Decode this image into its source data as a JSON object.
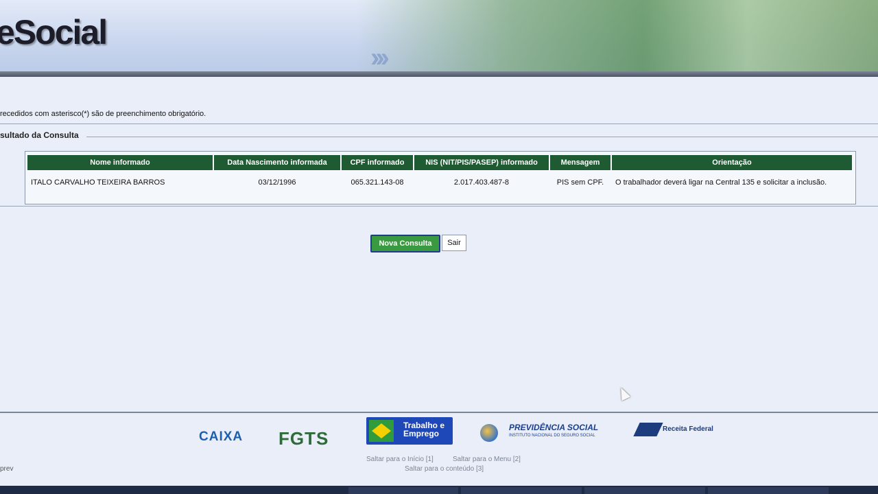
{
  "header": {
    "logo_text": "eSocial"
  },
  "form": {
    "required_note": "recedidos com asterisco(*) são de preenchimento obrigatório.",
    "section_title": "sultado da Consulta"
  },
  "table": {
    "headers": [
      "Nome informado",
      "Data Nascimento informada",
      "CPF informado",
      "NIS (NIT/PIS/PASEP) informado",
      "Mensagem",
      "Orientação"
    ],
    "rows": [
      {
        "nome": "ITALO CARVALHO TEIXEIRA BARROS",
        "data_nascimento": "03/12/1996",
        "cpf": "065.321.143-08",
        "nis": "2.017.403.487-8",
        "mensagem": "PIS sem CPF.",
        "orientacao": "O trabalhador deverá ligar na Central 135 e solicitar a inclusão."
      }
    ]
  },
  "buttons": {
    "nova_consulta": "Nova Consulta",
    "sair": "Sair"
  },
  "footer": {
    "logos": {
      "caixa": "CAIXA",
      "fgts": "FGTS",
      "mte_line1": "Trabalho e",
      "mte_line2": "Emprego",
      "previdencia_title": "PREVIDÊNCIA SOCIAL",
      "previdencia_sub": "INSTITUTO NACIONAL DO SEGURO SOCIAL",
      "receita": "Receita Federal"
    },
    "skip_links": {
      "inicio": "Saltar para o Início [1]",
      "menu": "Saltar para o Menu [2]",
      "conteudo": "Saltar para o conteúdo [3]"
    },
    "corner_text": "prev"
  }
}
